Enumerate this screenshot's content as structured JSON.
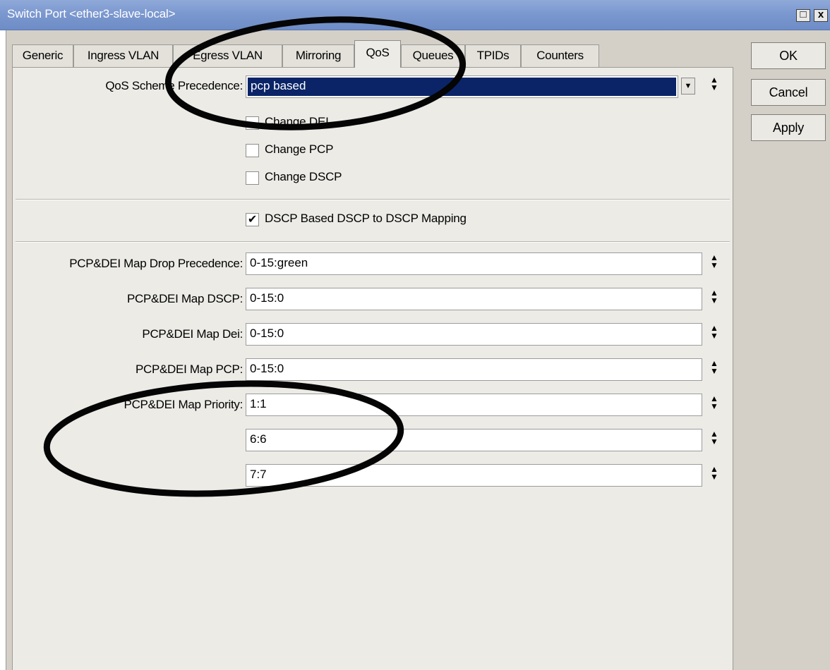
{
  "window": {
    "title": "Switch Port <ether3-slave-local>",
    "maximize_glyph": "□",
    "close_glyph": "x"
  },
  "tabs": [
    {
      "label": "Generic",
      "active": false
    },
    {
      "label": "Ingress VLAN",
      "active": false
    },
    {
      "label": "Egress VLAN",
      "active": false
    },
    {
      "label": "Mirroring",
      "active": false
    },
    {
      "label": "QoS",
      "active": true
    },
    {
      "label": "Queues",
      "active": false
    },
    {
      "label": "TPIDs",
      "active": false
    },
    {
      "label": "Counters",
      "active": false
    }
  ],
  "qos": {
    "scheme_label": "QoS Scheme Precedence:",
    "scheme_value": "pcp based",
    "checkboxes": [
      {
        "label": "Change DEI",
        "checked": false
      },
      {
        "label": "Change PCP",
        "checked": false
      },
      {
        "label": "Change DSCP",
        "checked": false
      }
    ],
    "dscp_mapping": {
      "label": "DSCP Based DSCP to DSCP Mapping",
      "checked": true
    },
    "drop_precedence": {
      "label": "PCP&DEI Map Drop Precedence:",
      "value": "0-15:green"
    },
    "map_dscp": {
      "label": "PCP&DEI Map DSCP:",
      "value": "0-15:0"
    },
    "map_dei": {
      "label": "PCP&DEI Map Dei:",
      "value": "0-15:0"
    },
    "map_pcp": {
      "label": "PCP&DEI Map PCP:",
      "value": "0-15:0"
    },
    "map_priority": {
      "label": "PCP&DEI Map Priority:",
      "values": [
        "1:1",
        "6:6",
        "7:7"
      ]
    }
  },
  "buttons": {
    "ok": "OK",
    "cancel": "Cancel",
    "apply": "Apply"
  },
  "icons": {
    "dropdown": "▼",
    "spinner_up": "▲",
    "spinner_down": "▼",
    "check": "✔"
  }
}
